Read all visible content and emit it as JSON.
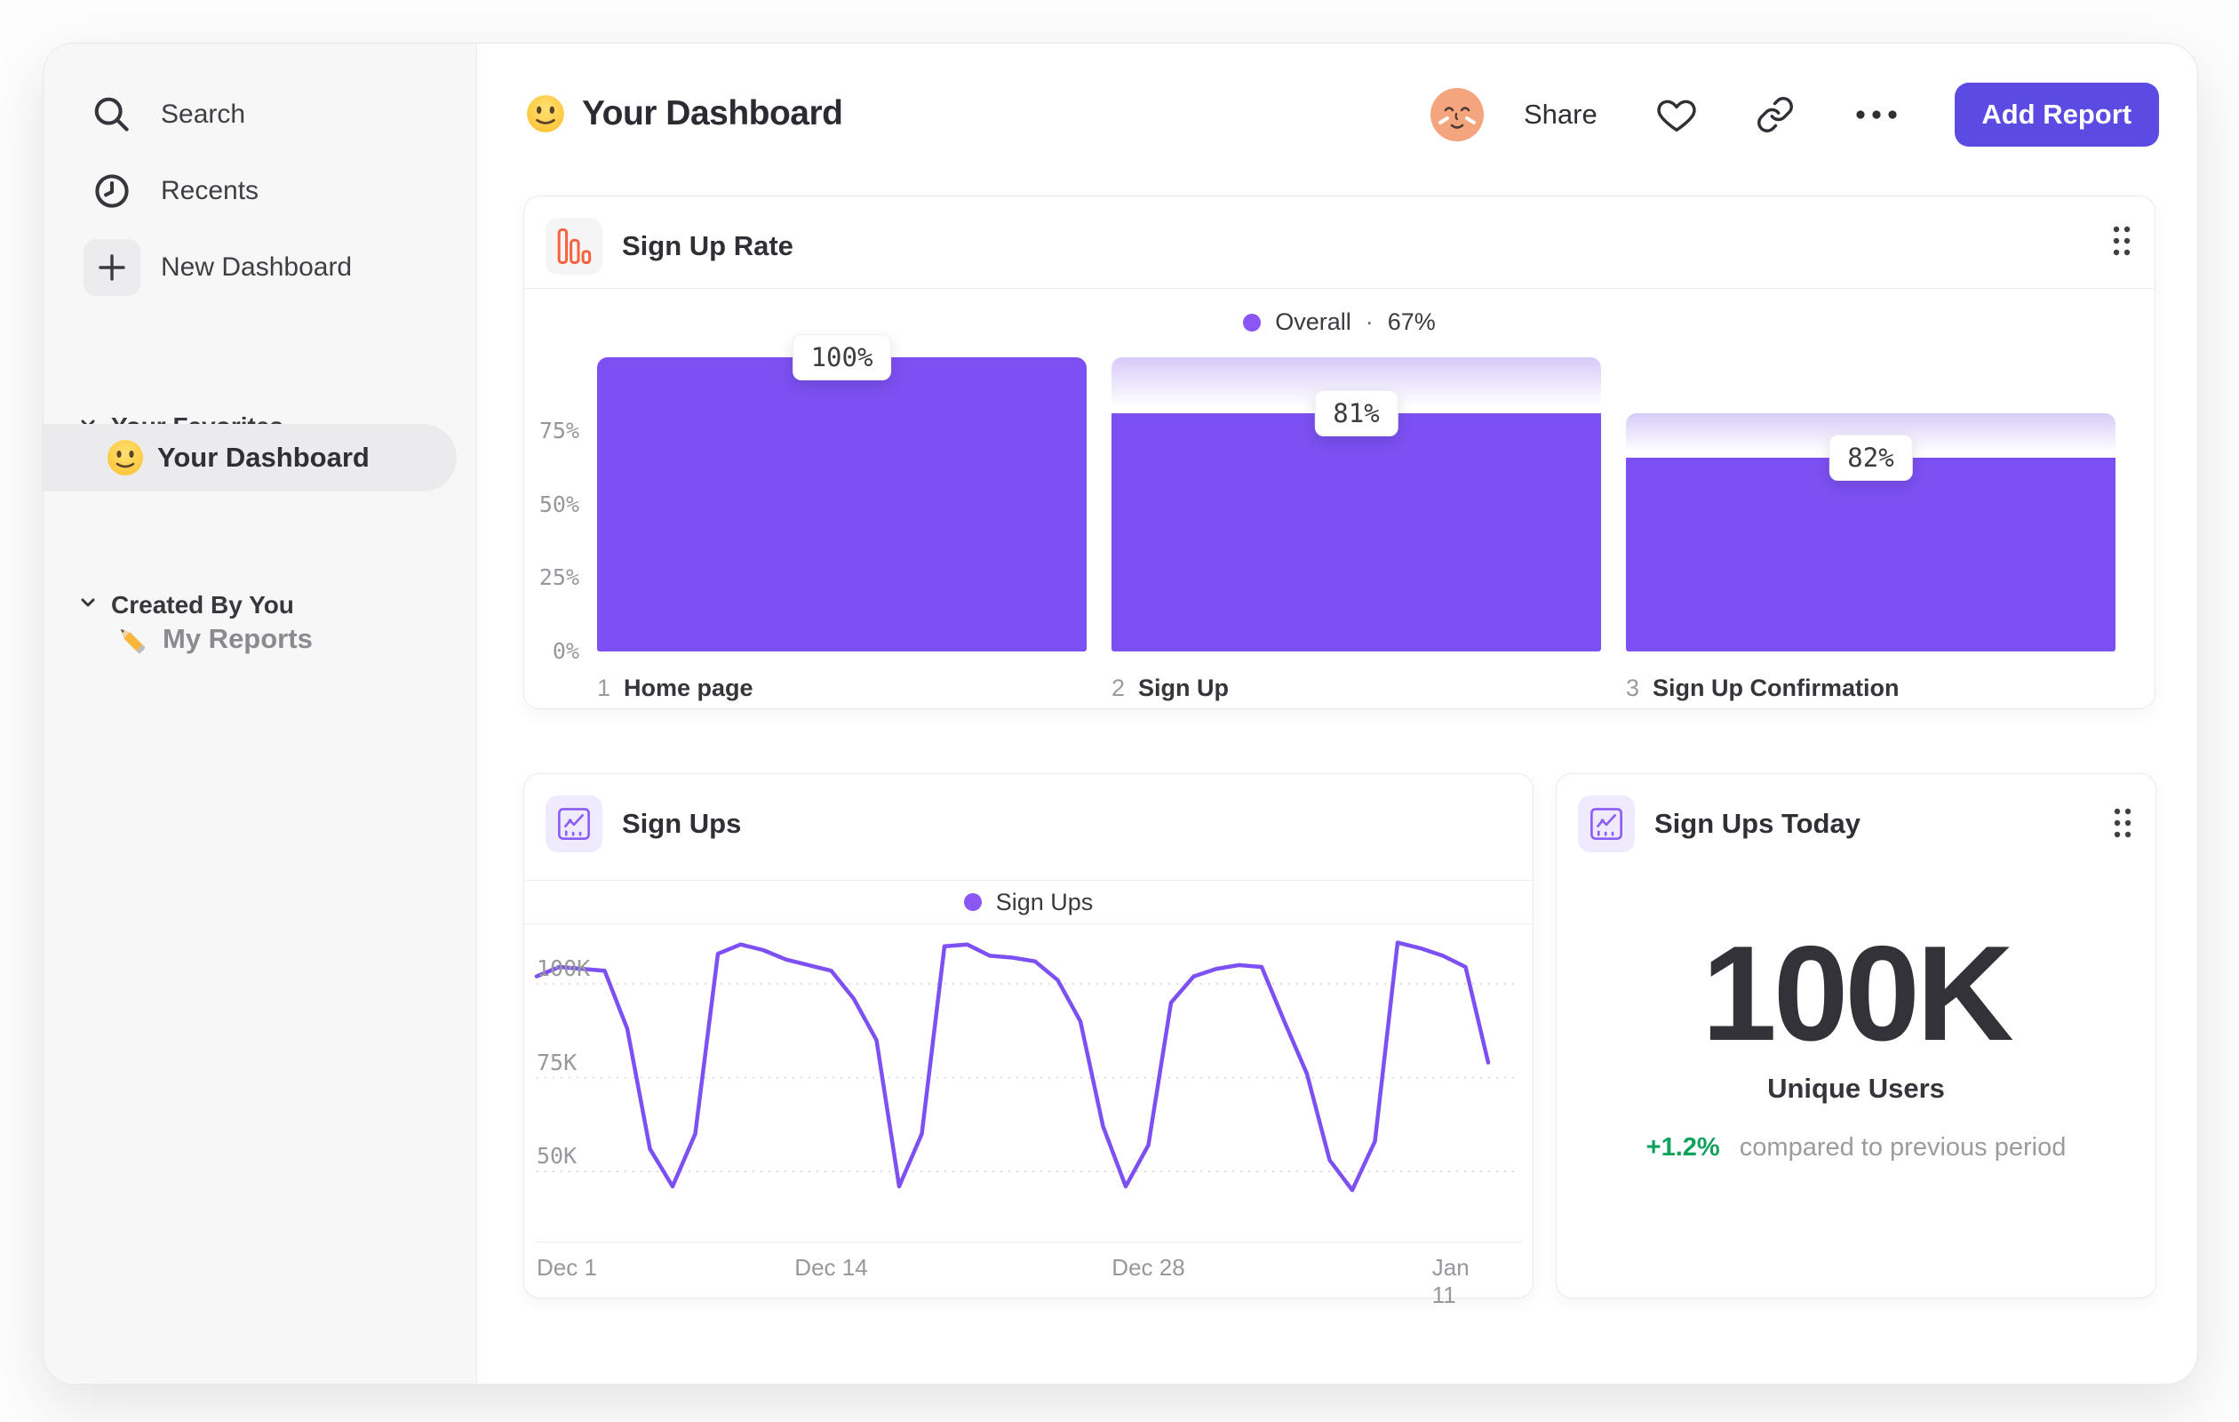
{
  "header": {
    "title": "Your Dashboard",
    "title_icon": "smiley-icon",
    "share_label": "Share",
    "add_report_label": "Add Report",
    "accent_color": "#5b4be3",
    "action_icons": [
      "avatar",
      "heart-icon",
      "link-icon",
      "ellipsis-icon"
    ]
  },
  "sidebar": {
    "items": [
      {
        "label": "Search",
        "icon": "search-icon"
      },
      {
        "label": "Recents",
        "icon": "clock-icon"
      },
      {
        "label": "New Dashboard",
        "icon": "plus-icon"
      }
    ],
    "sections": [
      {
        "label": "Your Favorites",
        "icon": "chevron-down-icon",
        "items": [
          {
            "label": "Your Dashboard",
            "icon": "smiley-icon",
            "selected": true
          }
        ]
      },
      {
        "label": "Created By You",
        "icon": "chevron-down-icon",
        "items": [
          {
            "label": "My Reports",
            "icon": "pencil-icon",
            "selected": false
          }
        ]
      }
    ]
  },
  "cards": {
    "signup_rate": {
      "title": "Sign Up Rate",
      "icon": "funnel-chart-icon",
      "icon_color": "#f4623e",
      "legend_label": "Overall",
      "legend_separator": "·",
      "legend_value": "67%"
    },
    "signups": {
      "title": "Sign Ups",
      "icon": "line-chart-icon",
      "icon_color": "#8b5cf6",
      "legend_label": "Sign Ups"
    },
    "signups_today": {
      "title": "Sign Ups Today",
      "icon": "line-chart-icon",
      "icon_color": "#8b5cf6",
      "value": "100K",
      "metric_label": "Unique Users",
      "delta": "+1.2%",
      "delta_note": "compared to previous period",
      "delta_color": "#0fa25e"
    }
  },
  "chart_data": [
    {
      "type": "bar",
      "title": "Sign Up Rate",
      "legend": "Overall · 67%",
      "categories": [
        "Home page",
        "Sign Up",
        "Sign Up Confirmation"
      ],
      "step_indices": [
        "1",
        "2",
        "3"
      ],
      "bar_labels": [
        "100%",
        "81%",
        "82%"
      ],
      "step_conversion_pct": [
        100,
        81,
        82
      ],
      "cumulative_pct": [
        100,
        81,
        66
      ],
      "yticks": [
        {
          "label": "75%",
          "value": 75
        },
        {
          "label": "50%",
          "value": 50
        },
        {
          "label": "25%",
          "value": 25
        },
        {
          "label": "0%",
          "value": 0
        }
      ],
      "ylim": [
        0,
        100
      ],
      "grid": false,
      "legend_position": "top-center",
      "bar_color": "#7c50f2",
      "gradient_top_color": "#d7caf8",
      "legend_dot_color": "#8a57f5"
    },
    {
      "type": "line",
      "title": "Sign Ups",
      "legend": "Sign Ups",
      "x_unit": "day (Dec 1 = 0)",
      "values": [
        102,
        104.5,
        104,
        103.5,
        88,
        56,
        46,
        60,
        108,
        110.5,
        109,
        106.5,
        105,
        103.5,
        96,
        85,
        46,
        60,
        110,
        110.5,
        107.5,
        107,
        106,
        101,
        90,
        62,
        46,
        57,
        95,
        102,
        104,
        105,
        104.5,
        90,
        76,
        53,
        45,
        58,
        111,
        109.5,
        107.5,
        104.5,
        79
      ],
      "values_unit": "K users",
      "xticks": [
        {
          "label": "Dec 1",
          "day": 0
        },
        {
          "label": "Dec 14",
          "day": 13
        },
        {
          "label": "Dec 28",
          "day": 27
        },
        {
          "label": "Jan 11",
          "day": 41
        }
      ],
      "yticks": [
        {
          "label": "100K",
          "value": 100
        },
        {
          "label": "75K",
          "value": 75
        },
        {
          "label": "50K",
          "value": 50
        }
      ],
      "ylim": [
        40,
        115
      ],
      "grid": "dotted horizontal",
      "legend_position": "top-center",
      "line_color": "#7c50f2",
      "legend_dot_color": "#8a57f5"
    }
  ]
}
